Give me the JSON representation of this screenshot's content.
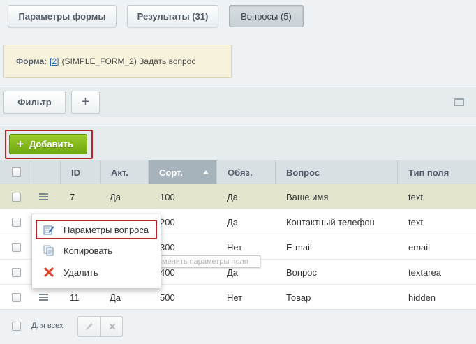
{
  "tabs": [
    {
      "label": "Параметры формы"
    },
    {
      "label": "Результаты (31)"
    },
    {
      "label": "Вопросы (5)"
    }
  ],
  "form_info": {
    "prefix": "Форма:",
    "link": "[2]",
    "text": "(SIMPLE_FORM_2) Задать вопрос"
  },
  "filter": {
    "label": "Фильтр",
    "add_symbol": "+"
  },
  "toolbar": {
    "add_label": "Добавить"
  },
  "columns": [
    {
      "label": "ID"
    },
    {
      "label": "Акт."
    },
    {
      "label": "Сорт."
    },
    {
      "label": "Обяз."
    },
    {
      "label": "Вопрос"
    },
    {
      "label": "Тип поля"
    }
  ],
  "rows": [
    {
      "id": "7",
      "active": "Да",
      "sort": "100",
      "required": "Да",
      "question": "Ваше имя",
      "type": "text"
    },
    {
      "id": "",
      "active": "",
      "sort": "200",
      "required": "Да",
      "question": "Контактный телефон",
      "type": "text"
    },
    {
      "id": "",
      "active": "",
      "sort": "300",
      "required": "Нет",
      "question": "E-mail",
      "type": "email"
    },
    {
      "id": "",
      "active": "",
      "sort": "400",
      "required": "Да",
      "question": "Вопрос",
      "type": "textarea"
    },
    {
      "id": "11",
      "active": "Да",
      "sort": "500",
      "required": "Нет",
      "question": "Товар",
      "type": "hidden"
    }
  ],
  "context_menu": {
    "items": [
      {
        "label": "Параметры вопроса",
        "icon": "edit-icon"
      },
      {
        "label": "Копировать",
        "icon": "copy-icon"
      },
      {
        "label": "Удалить",
        "icon": "delete-icon"
      }
    ]
  },
  "tooltip": "Изменить параметры поля",
  "footer": {
    "all_label": "Для всех"
  },
  "colors": {
    "accent_green": "#7cb518",
    "highlight_row": "#e3e6cd",
    "outline_red": "#b7262a"
  }
}
